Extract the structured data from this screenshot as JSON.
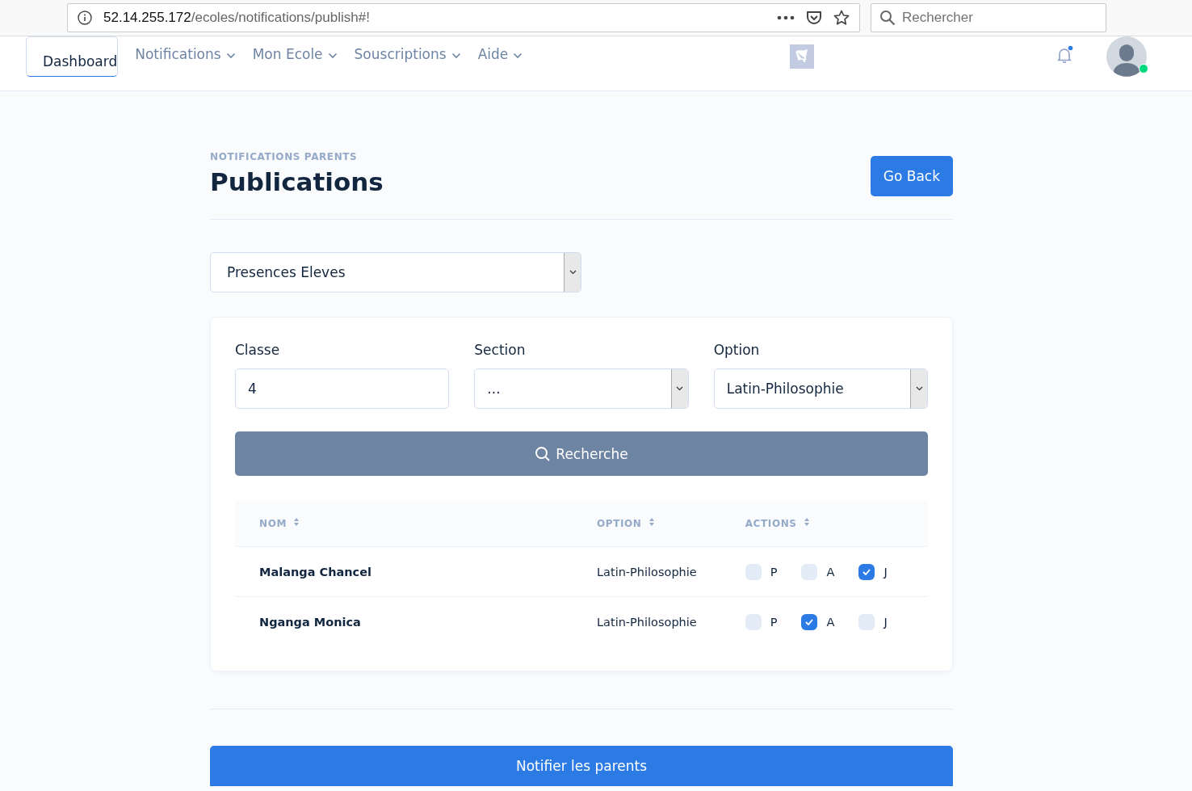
{
  "browser": {
    "url_host": "52.14.255.172",
    "url_path": "/ecoles/notifications/publish#!",
    "search_placeholder": "Rechercher"
  },
  "nav": {
    "items": [
      {
        "label": "Dashboard",
        "selected": true,
        "dropdown": false
      },
      {
        "label": "Notifications",
        "selected": false,
        "dropdown": true
      },
      {
        "label": "Mon Ecole",
        "selected": false,
        "dropdown": true
      },
      {
        "label": "Souscriptions",
        "selected": false,
        "dropdown": true
      },
      {
        "label": "Aide",
        "selected": false,
        "dropdown": true
      }
    ],
    "has_notification": true,
    "online": true
  },
  "header": {
    "eyebrow": "NOTIFICATIONS PARENTS",
    "title": "Publications",
    "back_button": "Go Back"
  },
  "type_select": {
    "value": "Presences Eleves"
  },
  "filters": [
    {
      "kind": "input",
      "label": "Classe",
      "value": "4"
    },
    {
      "kind": "select",
      "label": "Section",
      "value": "..."
    },
    {
      "kind": "select",
      "label": "Option",
      "value": "Latin-Philosophie"
    }
  ],
  "search_button": "Recherche",
  "table": {
    "columns": [
      "NOM",
      "OPTION",
      "ACTIONS"
    ],
    "rows": [
      {
        "name": "Malanga Chancel",
        "option": "Latin-Philosophie",
        "actions": [
          {
            "label": "P",
            "checked": false
          },
          {
            "label": "A",
            "checked": false
          },
          {
            "label": "J",
            "checked": true
          }
        ]
      },
      {
        "name": "Nganga Monica",
        "option": "Latin-Philosophie",
        "actions": [
          {
            "label": "P",
            "checked": false
          },
          {
            "label": "A",
            "checked": true
          },
          {
            "label": "J",
            "checked": false
          }
        ]
      }
    ]
  },
  "submit_button": "Notifier les parents"
}
